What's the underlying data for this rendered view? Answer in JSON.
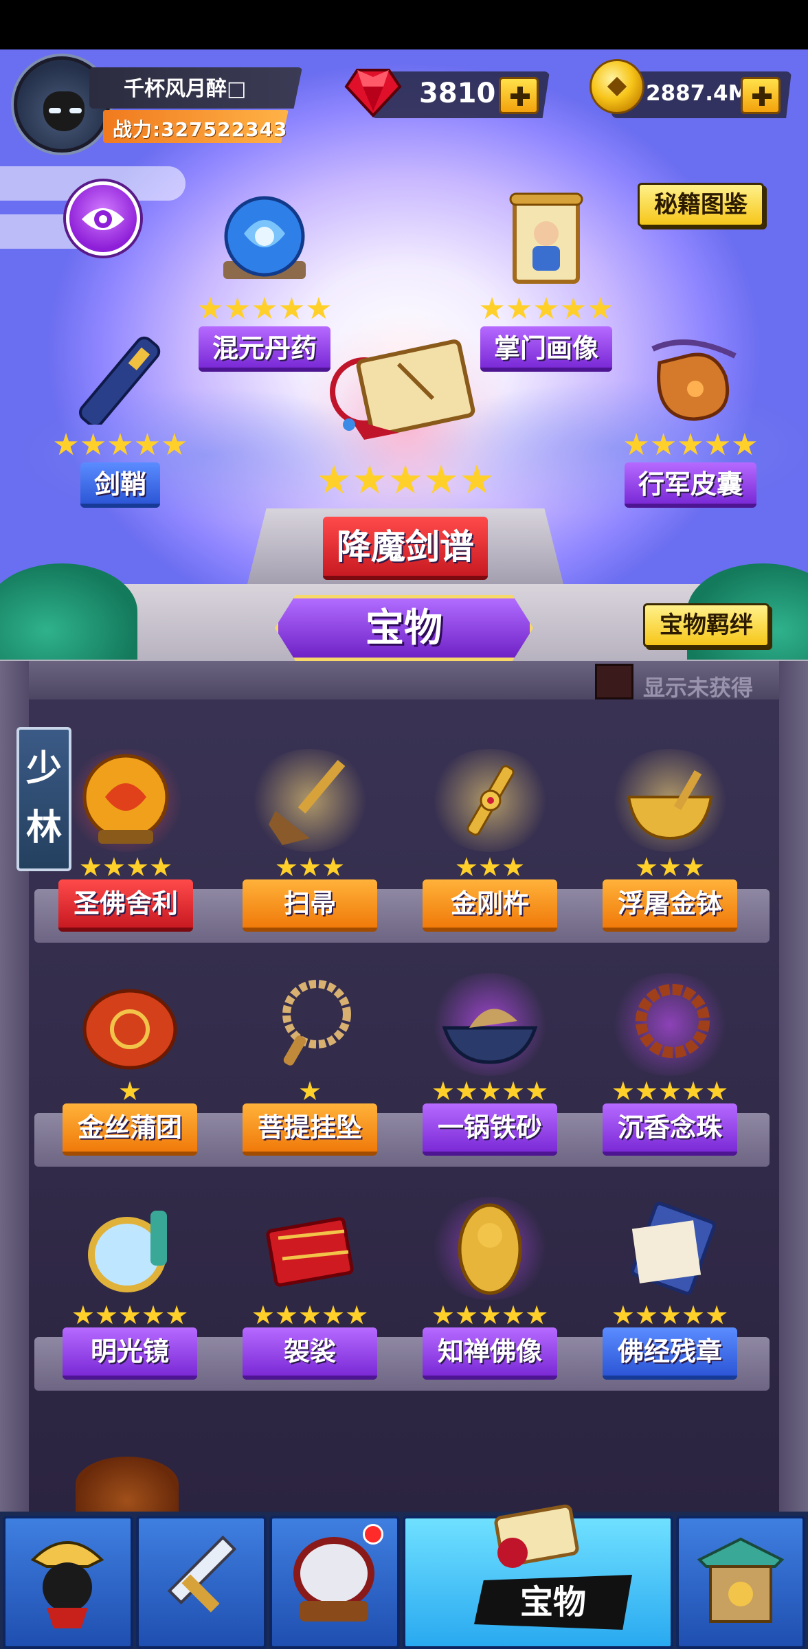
{
  "player": {
    "name": "千杯风月醉□",
    "power": "战力:327522343"
  },
  "currency": {
    "gems": "3810",
    "gold": "2887.4M"
  },
  "buttons": {
    "codex": "秘籍图鉴",
    "bond": "宝物羁绊"
  },
  "display": {
    "items": [
      {
        "name": "混元丹药",
        "stars": "★★★★★",
        "rarity": "purple"
      },
      {
        "name": "掌门画像",
        "stars": "★★★★★",
        "rarity": "purple"
      },
      {
        "name": "剑鞘",
        "stars": "★★★★★",
        "rarity": "blue"
      },
      {
        "name": "行军皮囊",
        "stars": "★★★★★",
        "rarity": "purple"
      },
      {
        "name": "降魔剑谱",
        "stars": "★★★★★",
        "rarity": "red"
      }
    ]
  },
  "title": "宝物",
  "shelf": {
    "toggle_label": "显示未获得",
    "sect_label": [
      "少",
      "林"
    ],
    "rows": [
      [
        {
          "name": "圣佛舍利",
          "stars": "★★★★",
          "rarity": "red"
        },
        {
          "name": "扫帚",
          "stars": "★★★",
          "rarity": "orange"
        },
        {
          "name": "金刚杵",
          "stars": "★★★",
          "rarity": "orange"
        },
        {
          "name": "浮屠金钵",
          "stars": "★★★",
          "rarity": "orange"
        }
      ],
      [
        {
          "name": "金丝蒲团",
          "stars": "★",
          "rarity": "orange"
        },
        {
          "name": "菩提挂坠",
          "stars": "★",
          "rarity": "orange"
        },
        {
          "name": "一锅铁砂",
          "stars": "★★★★★",
          "rarity": "purple"
        },
        {
          "name": "沉香念珠",
          "stars": "★★★★★",
          "rarity": "purple"
        }
      ],
      [
        {
          "name": "明光镜",
          "stars": "★★★★★",
          "rarity": "purple"
        },
        {
          "name": "袈裟",
          "stars": "★★★★★",
          "rarity": "purple"
        },
        {
          "name": "知禅佛像",
          "stars": "★★★★★",
          "rarity": "purple"
        },
        {
          "name": "佛经残章",
          "stars": "★★★★★",
          "rarity": "blue"
        }
      ]
    ]
  },
  "nav": {
    "active_label": "宝物"
  },
  "colors": {
    "accent_gold": "#ffd02a",
    "purple": "#7b2ad6",
    "blue": "#2c56d6",
    "red": "#c81a22",
    "orange": "#f07a0a"
  }
}
